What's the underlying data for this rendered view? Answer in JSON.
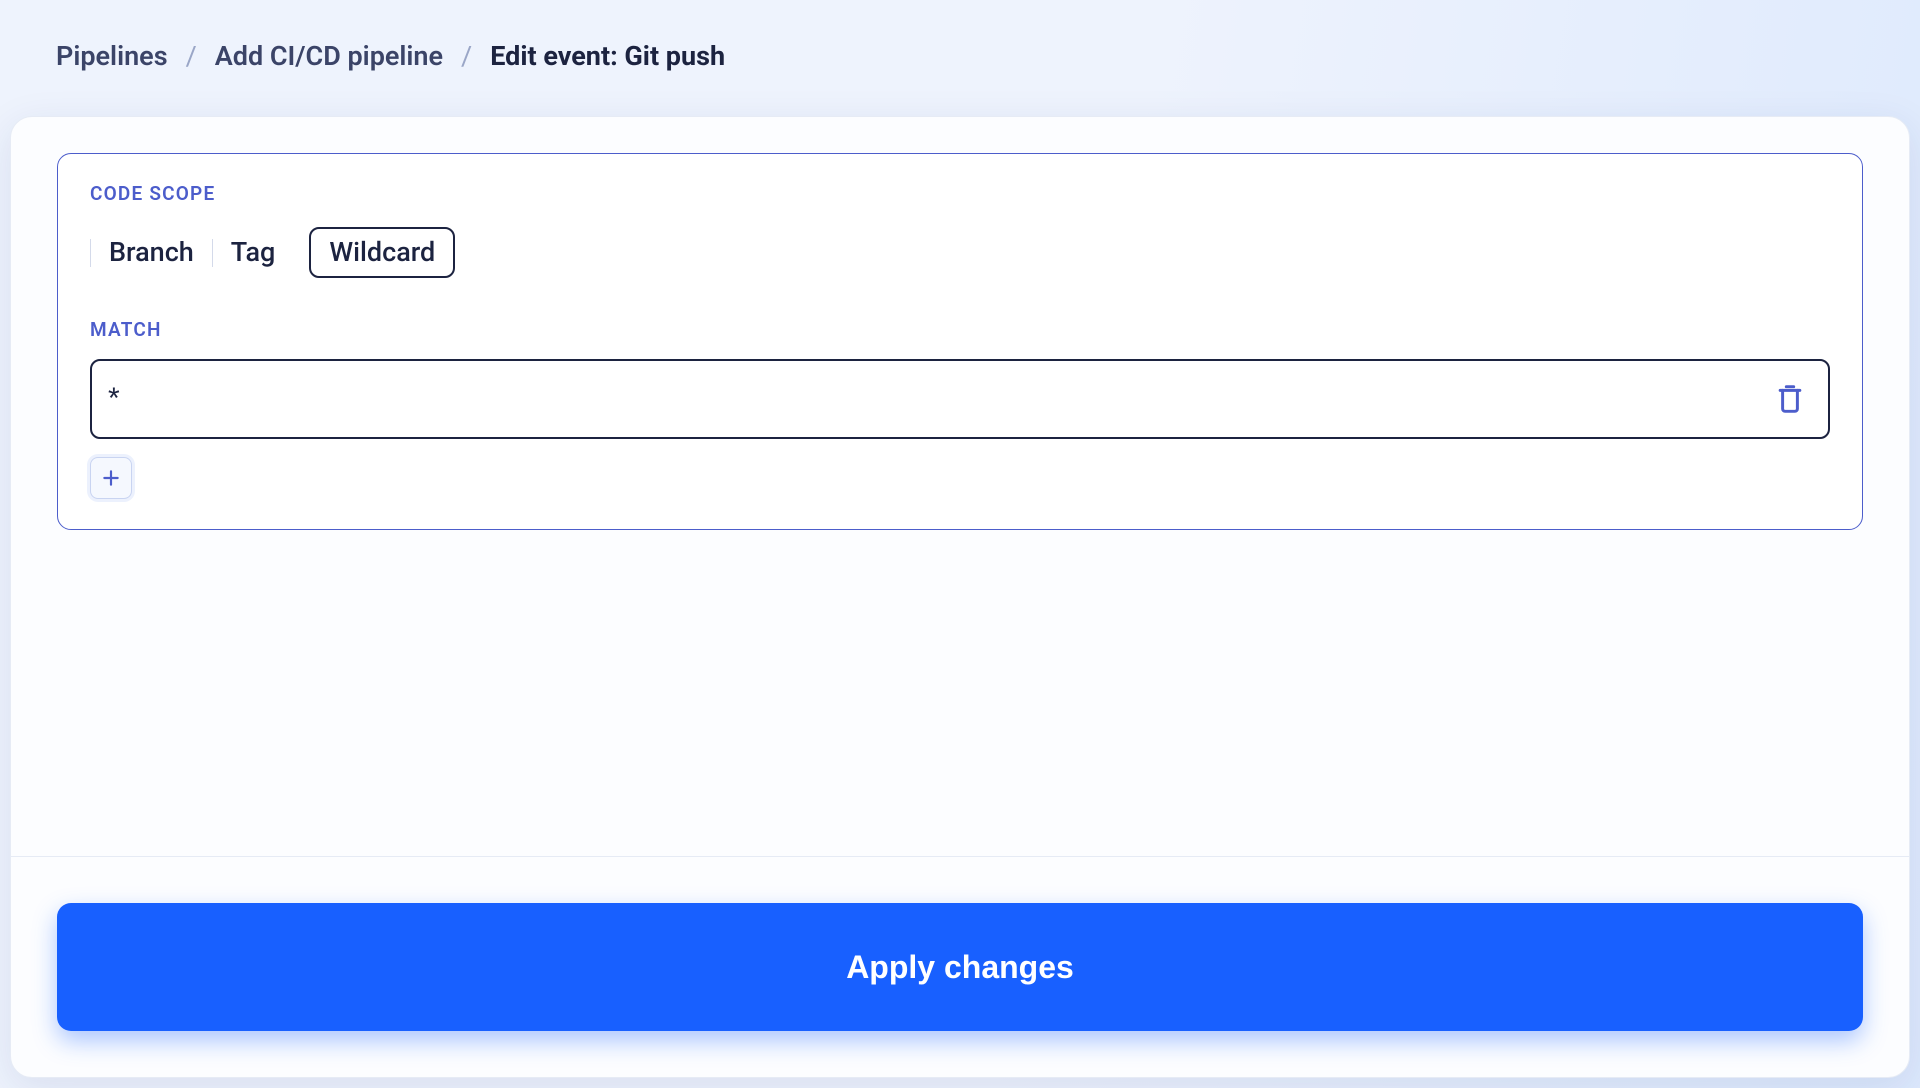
{
  "breadcrumb": {
    "items": [
      "Pipelines",
      "Add CI/CD pipeline"
    ],
    "current": "Edit event: Git push"
  },
  "panel": {
    "scope_label": "CODE SCOPE",
    "scope_options": {
      "branch": "Branch",
      "tag": "Tag",
      "wildcard": "Wildcard"
    },
    "scope_selected": "wildcard",
    "match_label": "MATCH",
    "match_value": "*"
  },
  "actions": {
    "apply": "Apply changes"
  },
  "icons": {
    "trash": "trash-icon",
    "plus": "plus-icon"
  }
}
